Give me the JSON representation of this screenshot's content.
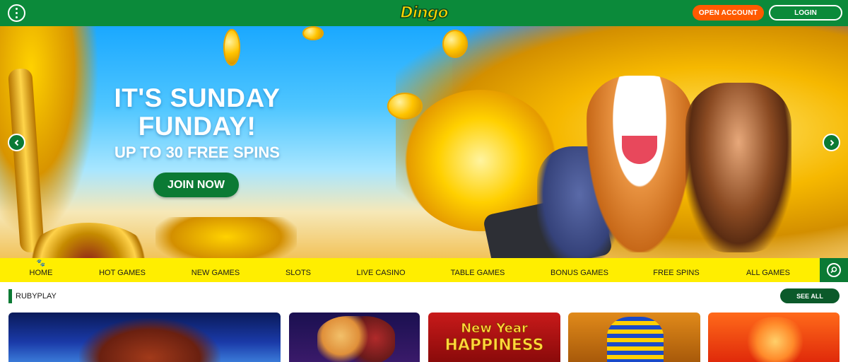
{
  "header": {
    "logo_text": "Dingo",
    "open_account_label": "OPEN ACCOUNT",
    "login_label": "LOGIN",
    "menu_icon": "kebab-menu-icon",
    "colors": {
      "header_bg": "#0b8a3a",
      "open_account_bg": "#ff5a00"
    }
  },
  "hero": {
    "title_line1": "IT'S SUNDAY",
    "title_line2": "FUNDAY!",
    "subtitle": "UP TO 30 FREE SPINS",
    "cta_label": "JOIN NOW",
    "prev_icon": "chevron-left-icon",
    "next_icon": "chevron-right-icon"
  },
  "nav": {
    "items": [
      {
        "label": "HOME",
        "icon": "paw-icon"
      },
      {
        "label": "HOT GAMES"
      },
      {
        "label": "NEW GAMES"
      },
      {
        "label": "SLOTS"
      },
      {
        "label": "LIVE CASINO"
      },
      {
        "label": "TABLE GAMES"
      },
      {
        "label": "BONUS GAMES"
      },
      {
        "label": "FREE SPINS"
      },
      {
        "label": "ALL GAMES"
      }
    ],
    "search_icon": "search-icon",
    "colors": {
      "nav_bg": "#ffee00",
      "search_bg": "#0b7a34"
    }
  },
  "section": {
    "title": "RUBYPLAY",
    "see_all_label": "SEE ALL",
    "tiles": [
      {
        "text_line1": "",
        "text_line2": ""
      },
      {
        "text_line1": "",
        "text_line2": ""
      },
      {
        "text_line1": "New Year",
        "text_line2": "HAPPINESS"
      },
      {
        "text_line1": "",
        "text_line2": ""
      },
      {
        "text_line1": "",
        "text_line2": ""
      }
    ]
  }
}
